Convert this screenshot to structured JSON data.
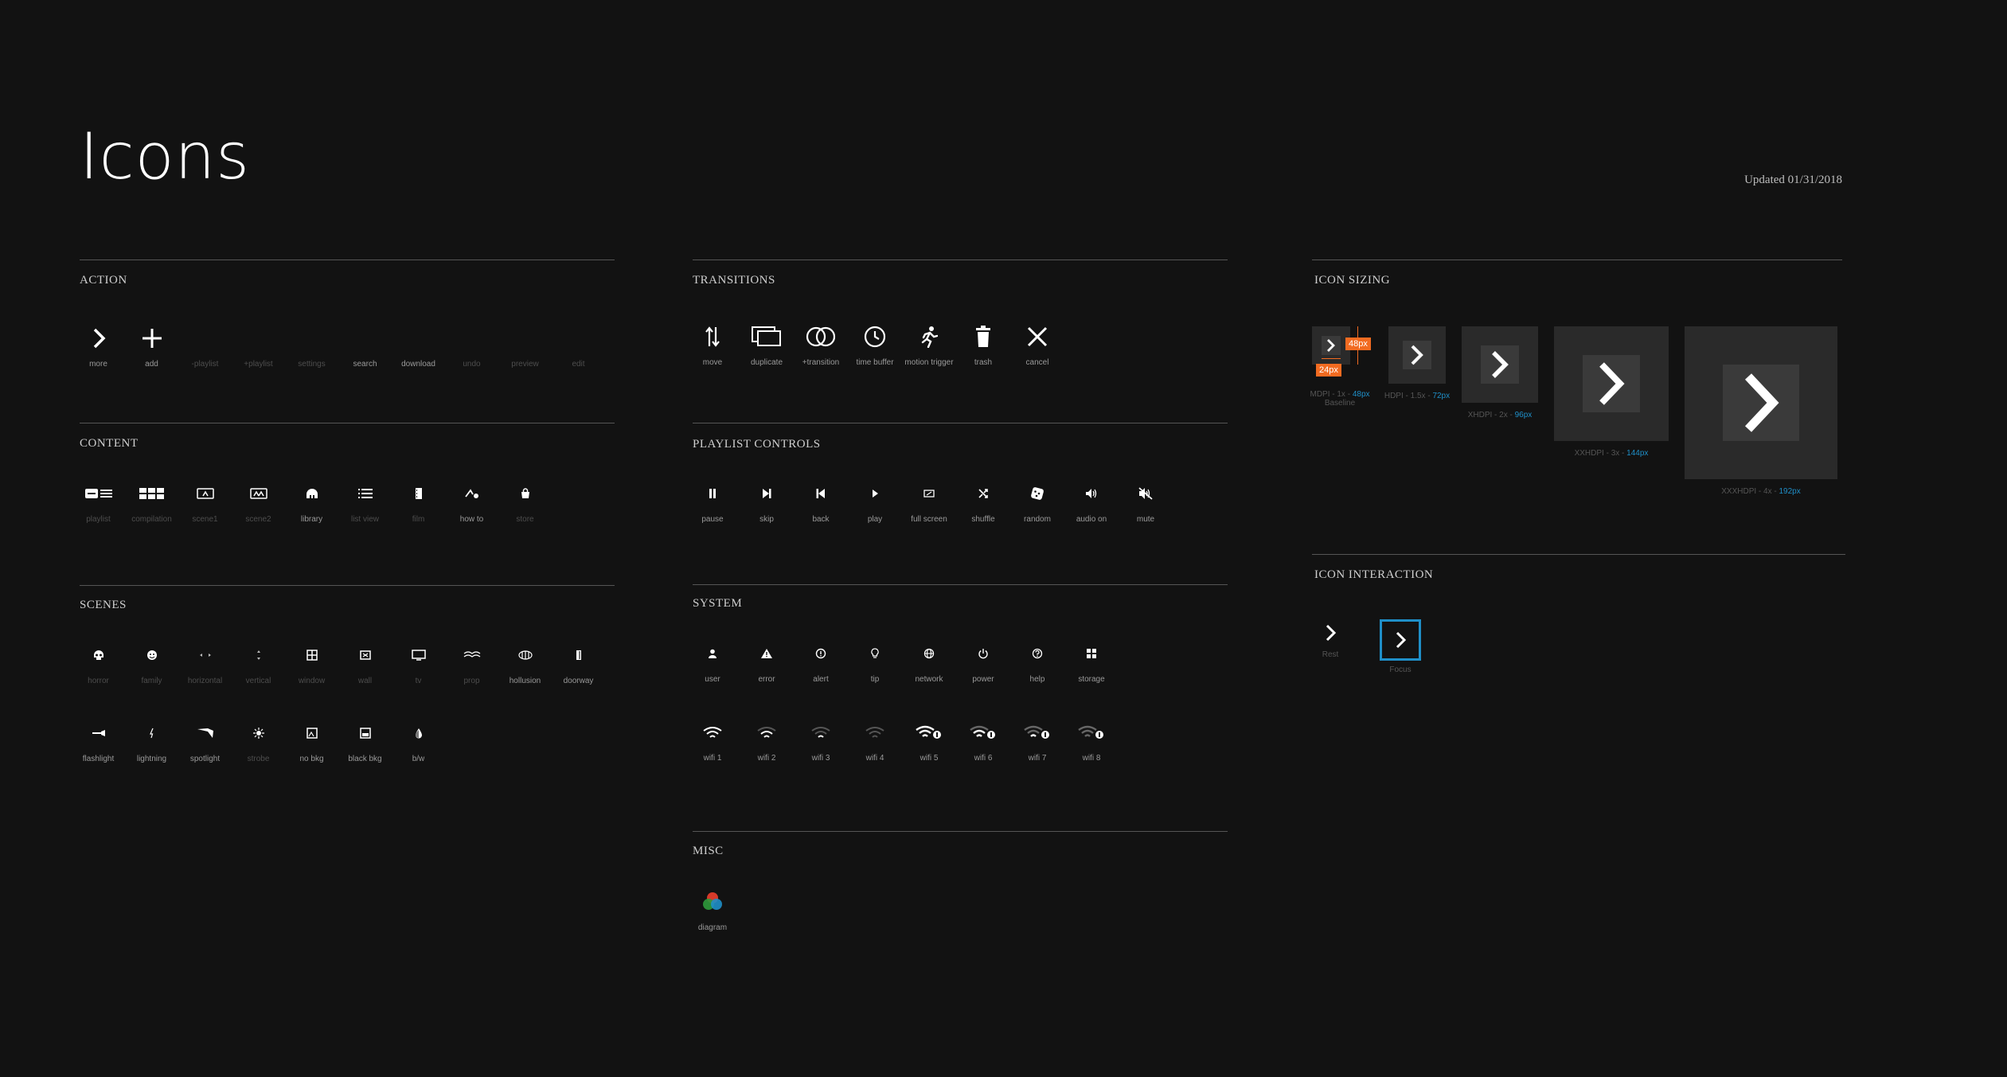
{
  "page": {
    "title": "Icons",
    "updated": "Updated 01/31/2018"
  },
  "colors": {
    "background": "#121212",
    "accent": "#1f8fc8",
    "measure_tag": "#f26b21"
  },
  "sections": {
    "action": {
      "title": "ACTION",
      "items": [
        {
          "label": "more",
          "icon": "chevron-right-icon"
        },
        {
          "label": "add",
          "icon": "plus-icon"
        },
        {
          "label": "-playlist",
          "icon": "minus-playlist-icon"
        },
        {
          "label": "+playlist",
          "icon": "plus-playlist-icon"
        },
        {
          "label": "settings",
          "icon": "settings-icon"
        },
        {
          "label": "search",
          "icon": "search-icon"
        },
        {
          "label": "download",
          "icon": "download-icon"
        },
        {
          "label": "undo",
          "icon": "undo-icon"
        },
        {
          "label": "preview",
          "icon": "preview-icon"
        },
        {
          "label": "edit",
          "icon": "edit-icon"
        }
      ]
    },
    "content": {
      "title": "CONTENT",
      "items": [
        {
          "label": "playlist",
          "icon": "playlist-icon"
        },
        {
          "label": "compilation",
          "icon": "compilation-icon"
        },
        {
          "label": "scene1",
          "icon": "scene1-icon"
        },
        {
          "label": "scene2",
          "icon": "scene2-icon"
        },
        {
          "label": "library",
          "icon": "library-icon"
        },
        {
          "label": "list view",
          "icon": "list-view-icon"
        },
        {
          "label": "film",
          "icon": "film-icon"
        },
        {
          "label": "how to",
          "icon": "how-to-icon"
        },
        {
          "label": "store",
          "icon": "store-icon"
        }
      ]
    },
    "scenes": {
      "title": "SCENES",
      "row1": [
        {
          "label": "horror",
          "icon": "skull-icon"
        },
        {
          "label": "family",
          "icon": "family-icon"
        },
        {
          "label": "horizontal",
          "icon": "horizontal-icon"
        },
        {
          "label": "vertical",
          "icon": "vertical-icon"
        },
        {
          "label": "window",
          "icon": "window-icon"
        },
        {
          "label": "wall",
          "icon": "wall-icon"
        },
        {
          "label": "tv",
          "icon": "tv-icon"
        },
        {
          "label": "prop",
          "icon": "prop-icon"
        },
        {
          "label": "hollusion",
          "icon": "hollusion-icon"
        },
        {
          "label": "doorway",
          "icon": "doorway-icon"
        }
      ],
      "row2": [
        {
          "label": "flashlight",
          "icon": "flashlight-icon"
        },
        {
          "label": "lightning",
          "icon": "lightning-icon"
        },
        {
          "label": "spotlight",
          "icon": "spotlight-icon"
        },
        {
          "label": "strobe",
          "icon": "strobe-icon"
        },
        {
          "label": "no bkg",
          "icon": "no-bkg-icon"
        },
        {
          "label": "black bkg",
          "icon": "black-bkg-icon"
        },
        {
          "label": "b/w",
          "icon": "bw-icon"
        }
      ]
    },
    "transitions": {
      "title": "TRANSITIONS",
      "items": [
        {
          "label": "move",
          "icon": "move-icon"
        },
        {
          "label": "duplicate",
          "icon": "duplicate-icon"
        },
        {
          "label": "+transition",
          "icon": "transition-icon"
        },
        {
          "label": "time buffer",
          "icon": "clock-icon"
        },
        {
          "label": "motion trigger",
          "icon": "running-person-icon"
        },
        {
          "label": "trash",
          "icon": "trash-icon"
        },
        {
          "label": "cancel",
          "icon": "close-icon"
        }
      ]
    },
    "playlist_controls": {
      "title": "PLAYLIST CONTROLS",
      "items": [
        {
          "label": "pause",
          "icon": "pause-icon"
        },
        {
          "label": "skip",
          "icon": "skip-icon"
        },
        {
          "label": "back",
          "icon": "back-icon"
        },
        {
          "label": "play",
          "icon": "play-icon"
        },
        {
          "label": "full screen",
          "icon": "full-screen-icon"
        },
        {
          "label": "shuffle",
          "icon": "shuffle-icon"
        },
        {
          "label": "random",
          "icon": "dice-icon"
        },
        {
          "label": "audio on",
          "icon": "audio-on-icon"
        },
        {
          "label": "mute",
          "icon": "mute-icon"
        }
      ]
    },
    "system": {
      "title": "SYSTEM",
      "row1": [
        {
          "label": "user",
          "icon": "user-icon"
        },
        {
          "label": "error",
          "icon": "error-icon"
        },
        {
          "label": "alert",
          "icon": "alert-icon"
        },
        {
          "label": "tip",
          "icon": "tip-icon"
        },
        {
          "label": "network",
          "icon": "network-icon"
        },
        {
          "label": "power",
          "icon": "power-icon"
        },
        {
          "label": "help",
          "icon": "help-icon"
        },
        {
          "label": "storage",
          "icon": "storage-icon"
        }
      ],
      "row2": [
        {
          "label": "wifi 1",
          "icon": "wifi-1-icon"
        },
        {
          "label": "wifi 2",
          "icon": "wifi-2-icon"
        },
        {
          "label": "wifi 3",
          "icon": "wifi-3-icon"
        },
        {
          "label": "wifi 4",
          "icon": "wifi-4-icon"
        },
        {
          "label": "wifi 5",
          "icon": "wifi-5-icon"
        },
        {
          "label": "wifi 6",
          "icon": "wifi-6-icon"
        },
        {
          "label": "wifi 7",
          "icon": "wifi-7-icon"
        },
        {
          "label": "wifi 8",
          "icon": "wifi-8-icon"
        }
      ]
    },
    "misc": {
      "title": "MISC",
      "items": [
        {
          "label": "diagram",
          "icon": "diagram-icon"
        }
      ]
    },
    "icon_sizing": {
      "title": "ICON SIZING",
      "tag_48": "48px",
      "tag_24": "24px",
      "mdpi": {
        "prefix": "MDPI - 1x - ",
        "size": "48px",
        "note": "Baseline"
      },
      "hdpi": {
        "prefix": "HDPI - 1.5x - ",
        "size": "72px"
      },
      "xhdpi": {
        "prefix": "XHDPI - 2x - ",
        "size": "96px"
      },
      "xxhdpi": {
        "prefix": "XXHDPI - 3x - ",
        "size": "144px"
      },
      "xxxhdpi": {
        "prefix": "XXXHDPI - 4x - ",
        "size": "192px"
      }
    },
    "icon_interaction": {
      "title": "ICON INTERACTION",
      "rest": "Rest",
      "focus": "Focus"
    }
  }
}
